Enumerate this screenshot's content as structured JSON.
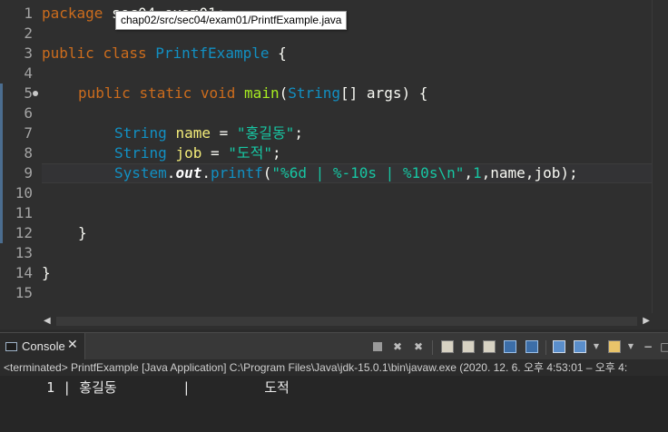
{
  "tooltip": "chap02/src/sec04/exam01/PrintfExample.java",
  "editor": {
    "line_numbers": [
      "1",
      "2",
      "3",
      "4",
      "5",
      "6",
      "7",
      "8",
      "9",
      "10",
      "11",
      "12",
      "13",
      "14",
      "15"
    ],
    "package_line_start": "package ",
    "package_line_hidden": "sec04.exam01;",
    "class_kw1": "public",
    "class_kw2": "class",
    "class_name": "PrintfExample",
    "brace_open": " {",
    "main_public": "public",
    "main_static": "static",
    "main_void": "void",
    "main_name": "main",
    "main_paren": "(",
    "main_type": "String",
    "main_arr": "[] ",
    "main_arg": "args",
    "main_close": ") {",
    "l7_type": "String",
    "l7_var": "name",
    "l7_eq": " = ",
    "l7_str": "\"홍길동\"",
    "l7_end": ";",
    "l8_type": "String",
    "l8_var": "job",
    "l8_eq": " = ",
    "l8_str": "\"도적\"",
    "l8_end": ";",
    "l9_cls": "System",
    "l9_dot1": ".",
    "l9_fld": "out",
    "l9_dot2": ".",
    "l9_meth": "printf",
    "l9_paren": "(",
    "l9_str": "\"%6d | %-10s | %10s\\n\"",
    "l9_c1": ",",
    "l9_num": "1",
    "l9_c2": ",",
    "l9_a1": "name",
    "l9_c3": ",",
    "l9_a2": "job",
    "l9_end": ");",
    "brace_close_inner": "}",
    "brace_close_outer": "}"
  },
  "console": {
    "tab_label": "Console",
    "status": "<terminated> PrintfExample [Java Application] C:\\Program Files\\Java\\jdk-15.0.1\\bin\\javaw.exe  (2020. 12. 6. 오후 4:53:01 – 오후 4:",
    "output": "     1 | 홍길동        |         도적"
  },
  "colors": {
    "editor_bg": "#2f2f2f",
    "keyword": "#cc6c1d",
    "type": "#1290c3",
    "string": "#17c6a3",
    "variable": "#f3ec79"
  }
}
